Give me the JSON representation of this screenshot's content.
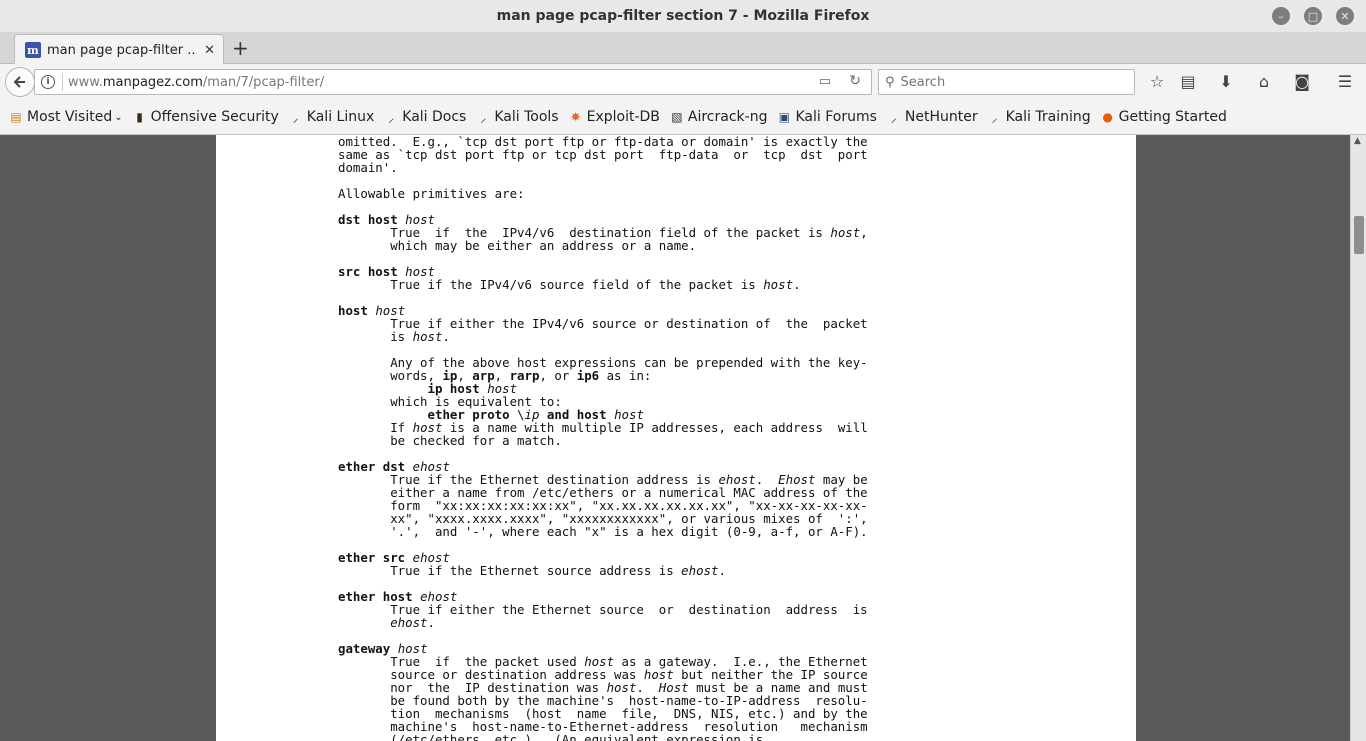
{
  "window": {
    "title": "man page pcap-filter section 7 - Mozilla Firefox",
    "buttons": {
      "minimize": "–",
      "maximize": "□",
      "close": "✕"
    }
  },
  "tab": {
    "label": "man page pcap-filter ...",
    "favicon": "m",
    "close": "✕",
    "new_tab": "+"
  },
  "nav": {
    "url_prefix": "www.",
    "url_domain": "manpagez.com",
    "url_path": "/man/7/pcap-filter/",
    "search_placeholder": "Search"
  },
  "bookmarks": [
    {
      "label": "Most Visited",
      "icon": "folder-icon",
      "glyph": "▤"
    },
    {
      "label": "Offensive Security",
      "icon": "offsec-icon",
      "glyph": "▮"
    },
    {
      "label": "Kali Linux",
      "icon": "kali-icon",
      "glyph": "⸝"
    },
    {
      "label": "Kali Docs",
      "icon": "kali-icon",
      "glyph": "⸝"
    },
    {
      "label": "Kali Tools",
      "icon": "kali-icon",
      "glyph": "⸝"
    },
    {
      "label": "Exploit-DB",
      "icon": "exploitdb-icon",
      "glyph": "✸"
    },
    {
      "label": "Aircrack-ng",
      "icon": "aircrack-icon",
      "glyph": "▧"
    },
    {
      "label": "Kali Forums",
      "icon": "kali-forums-icon",
      "glyph": "▣"
    },
    {
      "label": "NetHunter",
      "icon": "kali-icon",
      "glyph": "⸝"
    },
    {
      "label": "Kali Training",
      "icon": "kali-icon",
      "glyph": "⸝"
    },
    {
      "label": "Getting Started",
      "icon": "firefox-icon",
      "glyph": "●"
    }
  ],
  "manpage": {
    "intro": [
      "omitted.  E.g., `tcp dst port ftp or ftp-data or domain' is exactly the",
      "same as `tcp dst port ftp or tcp dst port  ftp-data  or  tcp  dst  port",
      "domain'."
    ],
    "allowable": "Allowable primitives are:",
    "entries": [
      {
        "term": "dst host",
        "arg": "host",
        "body": "       True  if  the  IPv4/v6  destination field of the packet is <i>host</i>,\n       which may be either an address or a name."
      },
      {
        "term": "src host",
        "arg": "host",
        "body": "       True if the IPv4/v6 source field of the packet is <i>host</i>."
      },
      {
        "term": "host",
        "arg": "host",
        "body": "       True if either the IPv4/v6 source or destination of  the  packet\n       is <i>host</i>.\n\n       Any of the above host expressions can be prepended with the key-\n       words, <b>ip</b>, <b>arp</b>, <b>rarp</b>, or <b>ip6</b> as in:\n            <b>ip host</b> <i>host</i>\n       which is equivalent to:\n            <b>ether proto</b> \\<i>ip</i> <b>and host</b> <i>host</i>\n       If <i>host</i> is a name with multiple IP addresses, each address  will\n       be checked for a match."
      },
      {
        "term": "ether dst",
        "arg": "ehost",
        "body": "       True if the Ethernet destination address is <i>ehost</i>.  <i>Ehost</i> may be\n       either a name from /etc/ethers or a numerical MAC address of the\n       form  \"xx:xx:xx:xx:xx:xx\", \"xx.xx.xx.xx.xx.xx\", \"xx-xx-xx-xx-xx-\n       xx\", \"xxxx.xxxx.xxxx\", \"xxxxxxxxxxxx\", or various mixes of  ':',\n       '.',  and '-', where each \"x\" is a hex digit (0-9, a-f, or A-F)."
      },
      {
        "term": "ether src",
        "arg": "ehost",
        "body": "       True if the Ethernet source address is <i>ehost</i>."
      },
      {
        "term": "ether host",
        "arg": "ehost",
        "body": "       True if either the Ethernet source  or  destination  address  is\n       <i>ehost</i>."
      },
      {
        "term": "gateway",
        "arg": "host",
        "body": "       True  if  the packet used <i>host</i> as a gateway.  I.e., the Ethernet\n       source or destination address was <i>host</i> but neither the IP source\n       nor  the  IP destination was <i>host</i>.  <i>Host</i> must be a name and must\n       be found both by the machine's  host-name-to-IP-address  resolu-\n       tion  mechanisms  (host  name  file,  DNS, NIS, etc.) and by the\n       machine's  host-name-to-Ethernet-address  resolution   mechanism\n       (/etc/ethers, etc.).  (An equivalent expression is"
      }
    ]
  }
}
